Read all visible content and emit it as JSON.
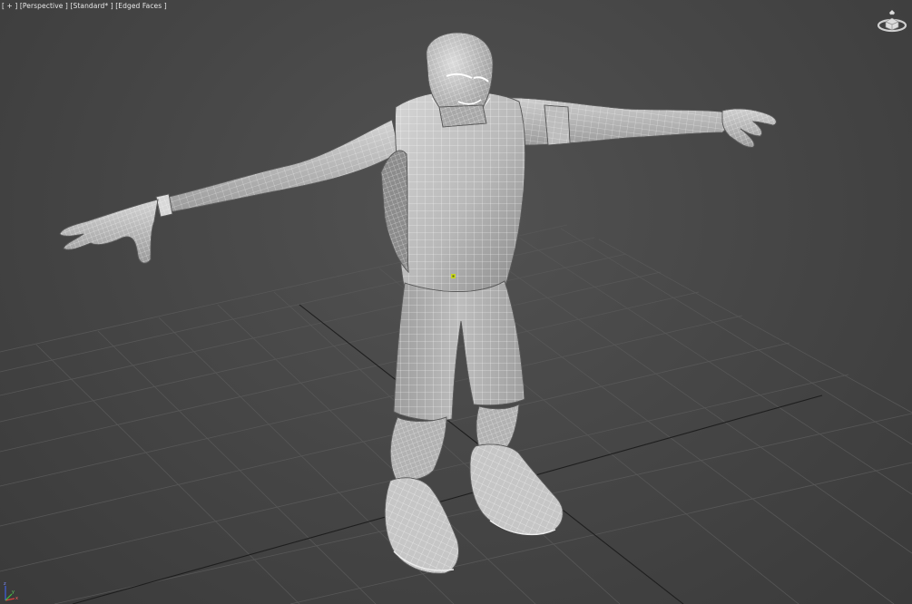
{
  "viewport": {
    "label_parts": [
      "[ + ]",
      "[Perspective ]",
      "[Standard* ]",
      "[Edged Faces ]"
    ],
    "view": "Perspective",
    "shading": "Standard*",
    "display_mode": "Edged Faces"
  },
  "icons": {
    "viewcube": "viewcube-home-icon",
    "axis": "xyz-axis-tripod-icon"
  },
  "colors": {
    "background": "#474747",
    "grid": "#5a5a5a",
    "grid_main_axis": "#1f1f1f",
    "mesh": "#c4c4c4",
    "wireframe": "#ffffff",
    "pivot": "#c8d820",
    "axis_x": "#e04040",
    "axis_y": "#40c040",
    "axis_z": "#4060e0"
  }
}
